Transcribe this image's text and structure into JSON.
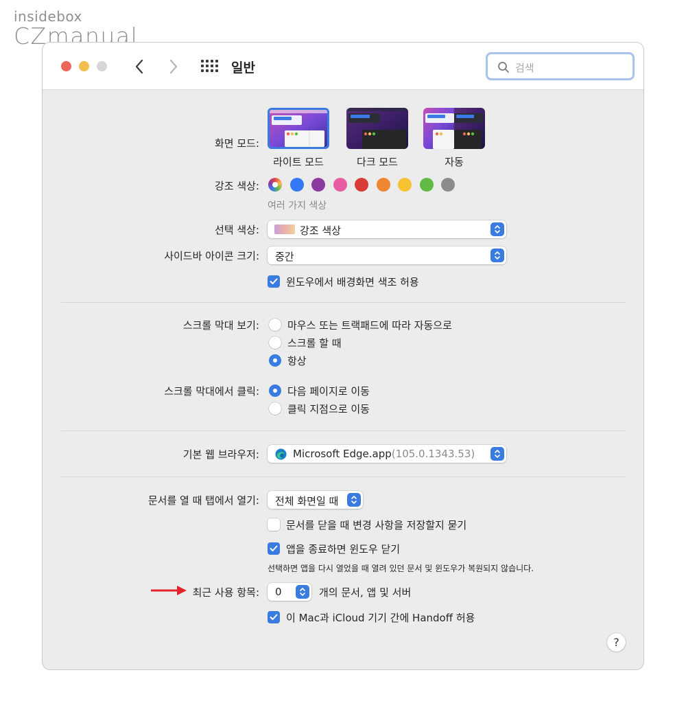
{
  "logo": {
    "line1": "insidebox",
    "line2": "CZmanual"
  },
  "window": {
    "title": "일반",
    "search_placeholder": "검색"
  },
  "appearance": {
    "label": "화면 모드:",
    "options": [
      "라이트 모드",
      "다크 모드",
      "자동"
    ],
    "selected": "라이트 모드"
  },
  "accent": {
    "label": "강조 색상:",
    "sublabel": "여러 가지 색상",
    "colors": [
      "multicolor",
      "#3478f6",
      "#8d3aa0",
      "#e55ea3",
      "#d83c37",
      "#ee8632",
      "#f7c333",
      "#62ba46",
      "#8c8c8c"
    ]
  },
  "highlight": {
    "label": "선택 색상:",
    "value": "강조 색상"
  },
  "sidebar_icon": {
    "label": "사이드바 아이콘 크기:",
    "value": "중간"
  },
  "wallpaper_tint": {
    "label": "윈도우에서 배경화면 색조 허용",
    "checked": true
  },
  "scrollbars": {
    "label": "스크롤 막대 보기:",
    "options": [
      "마우스 또는 트랙패드에 따라 자동으로",
      "스크롤 할 때",
      "항상"
    ],
    "selected": "항상"
  },
  "scroll_click": {
    "label": "스크롤 막대에서 클릭:",
    "options": [
      "다음 페이지로 이동",
      "클릭 지점으로 이동"
    ],
    "selected": "다음 페이지로 이동"
  },
  "browser": {
    "label": "기본 웹 브라우저:",
    "app": "Microsoft Edge.app",
    "version": "(105.0.1343.53)"
  },
  "tabs": {
    "label": "문서를 열 때 탭에서 열기:",
    "value": "전체 화면일 때"
  },
  "ask_save": {
    "label": "문서를 닫을 때 변경 사항을 저장할지 묻기",
    "checked": false
  },
  "close_windows": {
    "label": "앱을 종료하면 윈도우 닫기",
    "checked": true,
    "note": "선택하면 앱을 다시 열었을 때 열려 있던 문서 및 윈도우가 복원되지 않습니다."
  },
  "recent": {
    "label": "최근 사용 항목:",
    "value": "0",
    "suffix": "개의 문서, 앱 및 서버"
  },
  "handoff": {
    "label": "이 Mac과 iCloud 기기 간에 Handoff 허용",
    "checked": true
  },
  "help": {
    "label": "?"
  },
  "colors": {
    "accent": "#3a7be0",
    "arrow": "#e3222b"
  }
}
